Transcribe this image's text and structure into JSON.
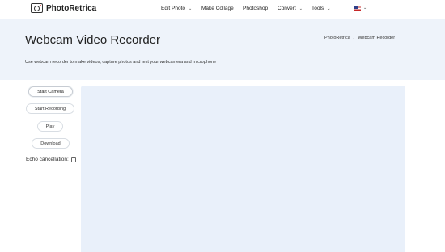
{
  "header": {
    "brand": "PhotoRetrica",
    "nav": [
      {
        "label": "Edit Photo",
        "has_dropdown": true
      },
      {
        "label": "Make Collage",
        "has_dropdown": false
      },
      {
        "label": "Photoshop",
        "has_dropdown": false
      },
      {
        "label": "Convert",
        "has_dropdown": true
      },
      {
        "label": "Tools",
        "has_dropdown": true
      }
    ],
    "language_icon": "us-flag-icon"
  },
  "hero": {
    "title": "Webcam Video Recorder",
    "breadcrumb": [
      "PhotoRetrica",
      "Webcam Recorder"
    ],
    "subtitle": "Use webcam recorder to make videos, capture photos and test your webcamera and microphone"
  },
  "controls": {
    "start_camera": "Start Camera",
    "start_recording": "Start Recording",
    "play": "Play",
    "download": "Download",
    "echo_label": "Echo cancellation:",
    "echo_checked": false
  },
  "colors": {
    "hero_bg": "#eef3fa",
    "video_bg": "#e9f0fa"
  }
}
